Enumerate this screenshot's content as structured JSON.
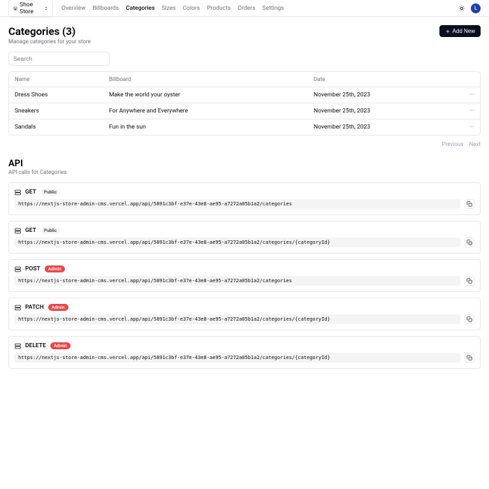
{
  "store": {
    "name": "Shoe Store"
  },
  "avatar": {
    "initial": "L"
  },
  "nav": [
    {
      "label": "Overview",
      "active": false
    },
    {
      "label": "Billboards",
      "active": false
    },
    {
      "label": "Categories",
      "active": true
    },
    {
      "label": "Sizes",
      "active": false
    },
    {
      "label": "Colors",
      "active": false
    },
    {
      "label": "Products",
      "active": false
    },
    {
      "label": "Orders",
      "active": false
    },
    {
      "label": "Settings",
      "active": false
    }
  ],
  "page": {
    "title": "Categories (3)",
    "desc": "Manage categories for your store",
    "add_label": "Add New",
    "search_placeholder": "Search"
  },
  "table": {
    "headers": {
      "name": "Name",
      "billboard": "Billboard",
      "date": "Date"
    },
    "rows": [
      {
        "name": "Dress Shoes",
        "billboard": "Make the world your oyster",
        "date": "November 25th, 2023"
      },
      {
        "name": "Sneakers",
        "billboard": "For Anywhere and Everywhere",
        "date": "November 25th, 2023"
      },
      {
        "name": "Sandals",
        "billboard": "Fun in the sun",
        "date": "November 25th, 2023"
      }
    ]
  },
  "pagination": {
    "prev": "Previous",
    "next": "Next"
  },
  "api": {
    "title": "API",
    "desc": "API calls for Categories",
    "base_url": "https://nextjs-store-admin-cms.vercel.app/api/5891c3bf-e37e-43e8-ae95-a7272a05b1a2/categories",
    "endpoints": [
      {
        "method": "GET",
        "badge": "Public",
        "badge_class": "public",
        "path": ""
      },
      {
        "method": "GET",
        "badge": "Public",
        "badge_class": "public",
        "path": "/{categoryId}"
      },
      {
        "method": "POST",
        "badge": "Admin",
        "badge_class": "admin",
        "path": ""
      },
      {
        "method": "PATCH",
        "badge": "Admin",
        "badge_class": "admin",
        "path": "/{categoryId}"
      },
      {
        "method": "DELETE",
        "badge": "Admin",
        "badge_class": "admin",
        "path": "/{categoryId}"
      }
    ]
  }
}
